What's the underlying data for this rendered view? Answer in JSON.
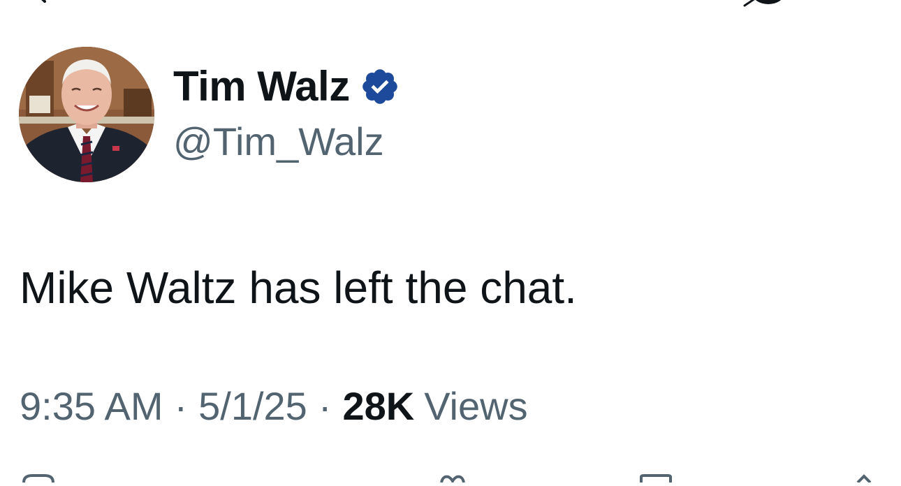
{
  "tweet": {
    "author": {
      "display_name": "Tim Walz",
      "handle": "@Tim_Walz",
      "verified": true
    },
    "text": "Mike Waltz has left the chat.",
    "meta": {
      "time": "9:35 AM",
      "separator": "·",
      "date": "5/1/25",
      "views_count": "28K",
      "views_label": "Views"
    }
  },
  "icons": {
    "back": "back-arrow-icon",
    "grok": "grok-icon",
    "verified": "verified-badge-icon",
    "reply": "reply-icon",
    "like": "like-icon",
    "bookmark": "bookmark-icon",
    "share": "share-icon"
  },
  "colors": {
    "text_primary": "#0f1419",
    "text_secondary": "#536471",
    "verified_blue": "#1d4a9b",
    "background": "#ffffff"
  }
}
